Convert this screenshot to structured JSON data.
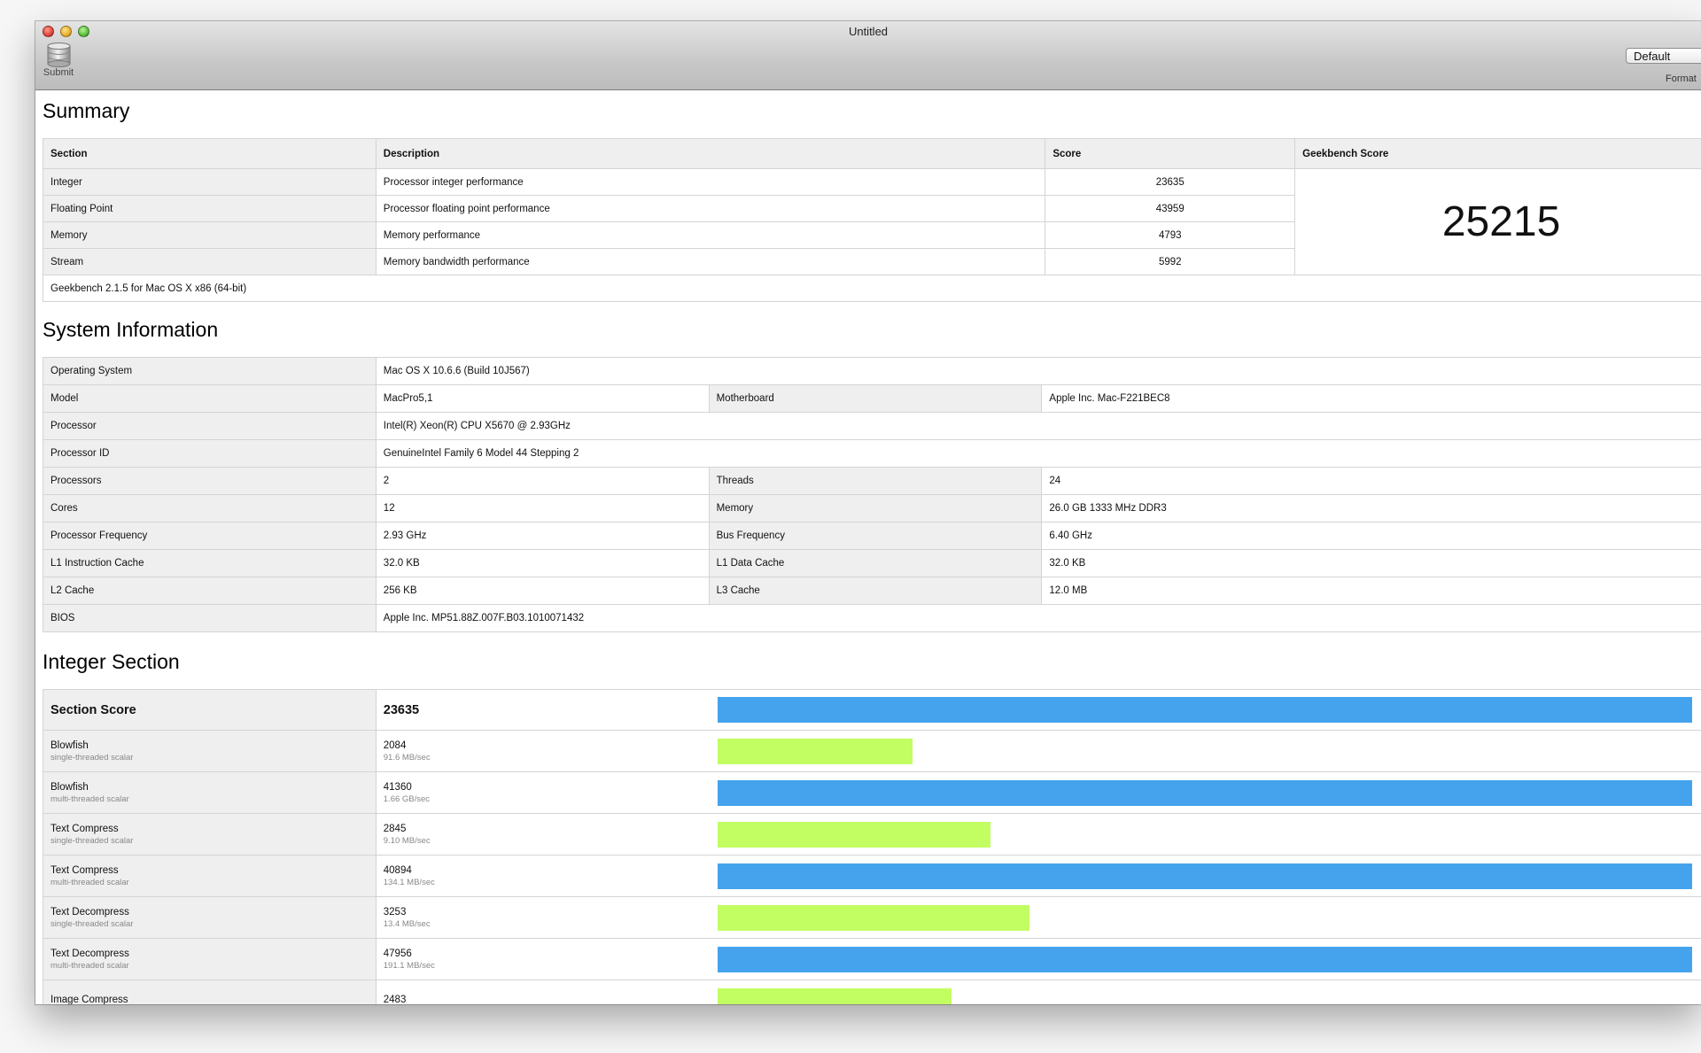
{
  "window": {
    "title": "Untitled"
  },
  "toolbar": {
    "submit_label": "Submit",
    "format_value": "Default",
    "format_label": "Format"
  },
  "summary": {
    "heading": "Summary",
    "columns": [
      "Section",
      "Description",
      "Score",
      "Geekbench Score"
    ],
    "rows": [
      {
        "section": "Integer",
        "description": "Processor integer performance",
        "score": "23635"
      },
      {
        "section": "Floating Point",
        "description": "Processor floating point performance",
        "score": "43959"
      },
      {
        "section": "Memory",
        "description": "Memory performance",
        "score": "4793"
      },
      {
        "section": "Stream",
        "description": "Memory bandwidth performance",
        "score": "5992"
      }
    ],
    "geekbench_score": "25215",
    "footer": "Geekbench 2.1.5 for Mac OS X x86 (64-bit)"
  },
  "sysinfo": {
    "heading": "System Information",
    "os": {
      "label": "Operating System",
      "value": "Mac OS X 10.6.6 (Build 10J567)"
    },
    "model": {
      "label": "Model",
      "value": "MacPro5,1"
    },
    "motherboard": {
      "label": "Motherboard",
      "value": "Apple Inc. Mac-F221BEC8"
    },
    "processor": {
      "label": "Processor",
      "value": "Intel(R) Xeon(R) CPU X5670 @ 2.93GHz"
    },
    "processor_id": {
      "label": "Processor ID",
      "value": "GenuineIntel Family 6 Model 44 Stepping 2"
    },
    "processors": {
      "label": "Processors",
      "value": "2"
    },
    "threads": {
      "label": "Threads",
      "value": "24"
    },
    "cores": {
      "label": "Cores",
      "value": "12"
    },
    "memory": {
      "label": "Memory",
      "value": "26.0 GB  1333 MHz DDR3"
    },
    "proc_freq": {
      "label": "Processor Frequency",
      "value": "2.93 GHz"
    },
    "bus_freq": {
      "label": "Bus Frequency",
      "value": "6.40 GHz"
    },
    "l1i": {
      "label": "L1 Instruction Cache",
      "value": "32.0 KB"
    },
    "l1d": {
      "label": "L1 Data Cache",
      "value": "32.0 KB"
    },
    "l2": {
      "label": "L2 Cache",
      "value": "256 KB"
    },
    "l3": {
      "label": "L3 Cache",
      "value": "12.0 MB"
    },
    "bios": {
      "label": "BIOS",
      "value": "Apple Inc. MP51.88Z.007F.B03.1010071432"
    }
  },
  "integer": {
    "heading": "Integer Section",
    "section_score_label": "Section Score",
    "section_score": "23635",
    "section_score_level": 1.0,
    "rows": [
      {
        "name": "Blowfish",
        "mode": "single-threaded scalar",
        "score": "2084",
        "rate": "91.6 MB/sec",
        "level": 0.2,
        "color": "#c2fd61"
      },
      {
        "name": "Blowfish",
        "mode": "multi-threaded scalar",
        "score": "41360",
        "rate": "1.66 GB/sec",
        "level": 1.0,
        "color": "#44a3ec"
      },
      {
        "name": "Text Compress",
        "mode": "single-threaded scalar",
        "score": "2845",
        "rate": "9.10 MB/sec",
        "level": 0.28,
        "color": "#c2fd61"
      },
      {
        "name": "Text Compress",
        "mode": "multi-threaded scalar",
        "score": "40894",
        "rate": "134.1 MB/sec",
        "level": 1.0,
        "color": "#44a3ec"
      },
      {
        "name": "Text Decompress",
        "mode": "single-threaded scalar",
        "score": "3253",
        "rate": "13.4 MB/sec",
        "level": 0.32,
        "color": "#c2fd61"
      },
      {
        "name": "Text Decompress",
        "mode": "multi-threaded scalar",
        "score": "47956",
        "rate": "191.1 MB/sec",
        "level": 1.0,
        "color": "#44a3ec"
      },
      {
        "name": "Image Compress",
        "mode": "",
        "score": "2483",
        "rate": "",
        "level": 0.24,
        "color": "#c2fd61"
      }
    ]
  }
}
